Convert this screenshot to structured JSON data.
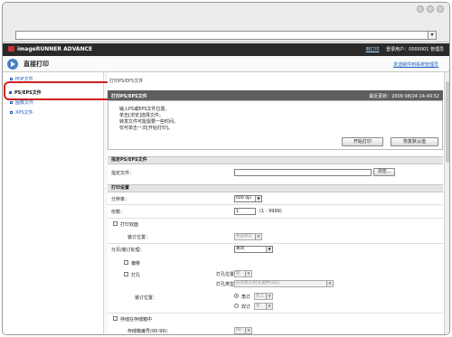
{
  "browser": {
    "addr_dropdown_glyph": "▾"
  },
  "header": {
    "brand": "imageRUNNER ADVANCE",
    "topright_link": "到打印",
    "topright_user": "登录用户：0000001 管理员"
  },
  "funcbar": {
    "title": "直接打印",
    "link": "发送邮件到系统管理员"
  },
  "sidebar": {
    "items": [
      {
        "label": "PDF文件"
      },
      {
        "label": "PS/EPS文件"
      },
      {
        "label": "图像文件"
      },
      {
        "label": "XPS文件"
      }
    ]
  },
  "main": {
    "breadcrumb": "打印PS/EPS文件",
    "panel_title": "打印PS/EPS文件",
    "last_update": "最近更新：2009 08/24 14:49:52",
    "notice": [
      "输入PS或EPS文件位置。",
      "单击[浏览]选择文件。",
      "转发文件可能需要一些时间。",
      "仅可单击一次[开始打印]。"
    ],
    "btn_start": "开始打印",
    "btn_reset": "恢复默认值",
    "sect_file": "指定PS/EPS文件",
    "file_label": "指定文件：",
    "file_value": "",
    "btn_browse": "浏览...",
    "sect_print": "打印设置",
    "resolution_label": "分辨率：",
    "resolution_value": "600 dpi",
    "copies_label": "份数：",
    "copies_value": "1",
    "copies_range": "(1 - 9999)",
    "duplex_label": "打印双面",
    "binding_label": "装订位置：",
    "binding_value": "长边装订",
    "finish_label": "分页/装订处理：",
    "finish_value": "关闭",
    "offset_label": "偏移",
    "punch_label": "打孔",
    "punch_pos_label": "打孔位置：",
    "punch_pos_value": "左",
    "punch_type_label": "打孔类型：",
    "punch_type_value": "分页装订/打孔组件(2孔)",
    "staple_pos_label": "装订位置：",
    "staple_corner_label": "角订",
    "staple_corner_value": "左上",
    "staple_double_label": "双订",
    "staple_double_value": "左",
    "store_label": "存储在存储箱中",
    "box_label": "存储箱编号(00-99)：",
    "box_value": "00"
  }
}
